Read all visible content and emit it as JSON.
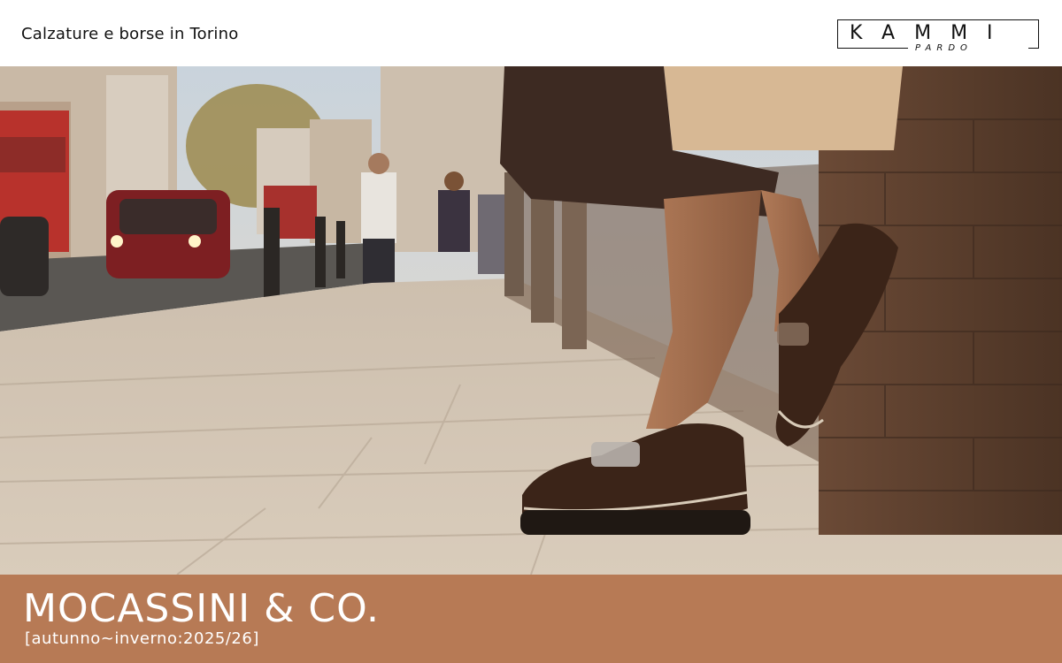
{
  "header": {
    "tagline": "Calzature e borse in Torino",
    "logo": {
      "main": "KAMMI",
      "sub": "PARDO"
    }
  },
  "hero": {
    "image": "street-scene-loafers-photo"
  },
  "band": {
    "title": "MOCASSINI & CO.",
    "subtitle": "[autunno~inverno:2025/26]"
  },
  "colors": {
    "band": "#b77a55",
    "header_bg": "#ffffff",
    "text_light": "#ffffff",
    "text_dark": "#111111"
  }
}
